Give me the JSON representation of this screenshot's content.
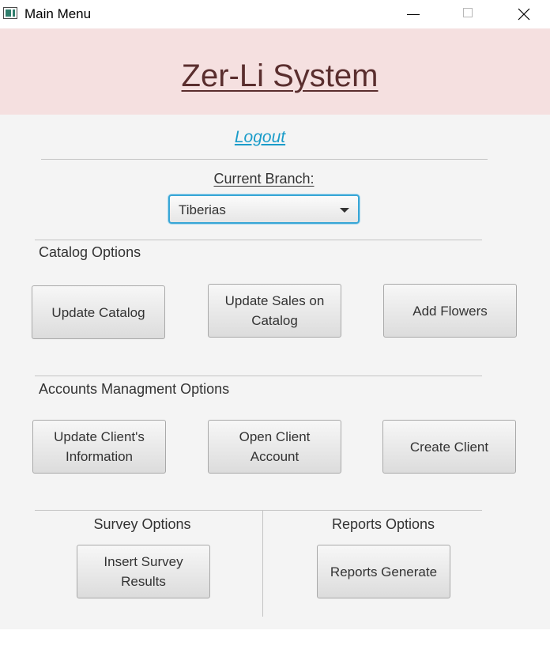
{
  "window": {
    "title": "Main Menu",
    "controls": {
      "minimize": "minimize",
      "maximize": "maximize",
      "close": "close"
    }
  },
  "header": {
    "title": "Zer-Li System",
    "background": "#f5e0e0"
  },
  "logout": {
    "label": "Logout",
    "color": "#1a9cc9"
  },
  "branch": {
    "label": "Current Branch:",
    "selected": "Tiberias"
  },
  "catalog": {
    "section_label": "Catalog Options",
    "buttons": [
      "Update Catalog",
      "Update Sales on Catalog",
      "Add Flowers"
    ]
  },
  "accounts": {
    "section_label": "Accounts Managment Options",
    "buttons": [
      "Update Client's Information",
      "Open Client Account",
      "Create Client"
    ]
  },
  "survey": {
    "section_label": "Survey Options",
    "button": "Insert Survey Results"
  },
  "reports": {
    "section_label": "Reports Options",
    "button": "Reports Generate"
  }
}
